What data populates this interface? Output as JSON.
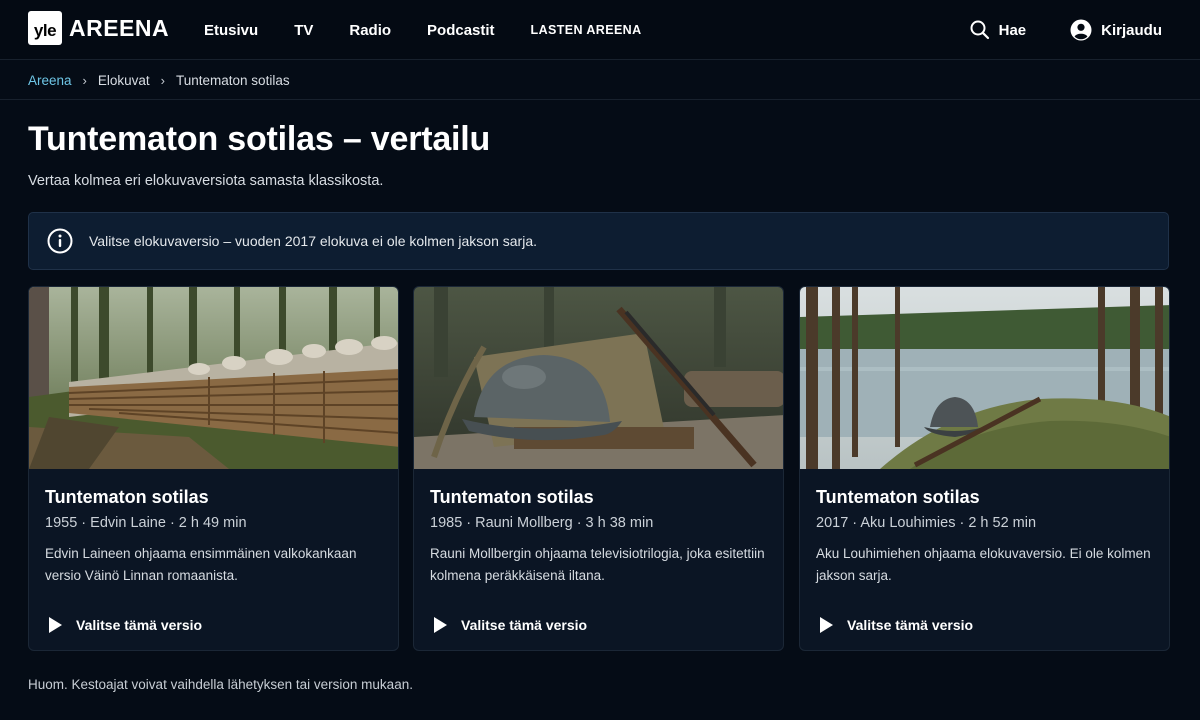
{
  "brand": {
    "logo_yle": "yle",
    "logo_areena": "AREENA"
  },
  "nav": {
    "items": [
      {
        "label": "Etusivu"
      },
      {
        "label": "TV"
      },
      {
        "label": "Radio"
      },
      {
        "label": "Podcastit"
      },
      {
        "label": "LASTEN AREENA"
      }
    ]
  },
  "header": {
    "search_label": "Hae",
    "search_icon": "search-icon",
    "login_label": "Kirjaudu",
    "login_icon": "user-icon"
  },
  "breadcrumb": {
    "items": [
      "Areena",
      "Elokuvat",
      "Tuntematon sotilas"
    ],
    "separator": "›"
  },
  "page": {
    "title": "Tuntematon sotilas – vertailu",
    "subtitle": "Vertaa kolmea eri elokuvaversiota samasta klassikosta."
  },
  "info": {
    "icon": "info-icon",
    "text": "Valitse elokuvaversio – vuoden 2017 elokuva ei ole kolmen jakson sarja."
  },
  "cards": [
    {
      "image": "trench-photo",
      "title": "Tuntematon sotilas",
      "meta": "1955 · Edvin Laine · 2 h 49 min",
      "description": "Edvin Laineen ohjaama ensimmäinen valkokankaan versio Väinö Linnan romaanista.",
      "button": "Valitse tämä versio"
    },
    {
      "image": "helmet-rifle-photo",
      "title": "Tuntematon sotilas",
      "meta": "1985 · Rauni Mollberg · 3 h 38 min",
      "description": "Rauni Mollbergin ohjaama televisiotrilogia, joka esitettiin kolmena peräkkäisenä iltana.",
      "button": "Valitse tämä versio"
    },
    {
      "image": "lake-helmet-photo",
      "title": "Tuntematon sotilas",
      "meta": "2017 · Aku Louhimies · 2 h 52 min",
      "description": "Aku Louhimiehen ohjaama elokuvaversio. Ei ole kolmen jakson sarja.",
      "button": "Valitse tämä versio"
    }
  ],
  "footnote": "Huom. Kestoajat voivat vaihdella lähetyksen tai version mukaan.",
  "colors": {
    "background": "#050c16",
    "accent": "#6ec6e6",
    "card": "#0b1524",
    "info_box": "#0d1d31"
  }
}
